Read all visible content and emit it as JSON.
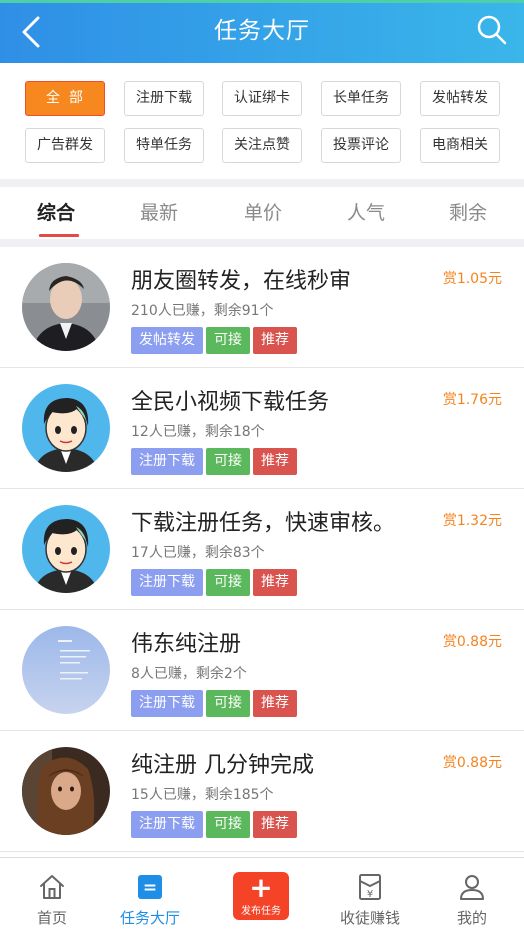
{
  "header": {
    "title": "任务大厅"
  },
  "filters": [
    "全部",
    "注册下载",
    "认证绑卡",
    "长单任务",
    "发帖转发",
    "广告群发",
    "特单任务",
    "关注点赞",
    "投票评论",
    "电商相关"
  ],
  "sort_tabs": [
    "综合",
    "最新",
    "单价",
    "人气",
    "剩余"
  ],
  "tasks": [
    {
      "title": "朋友圈转发，在线秒审",
      "meta": "210人已赚，剩余91个",
      "reward": "赏1.05元",
      "tags": [
        "发帖转发",
        "可接",
        "推荐"
      ]
    },
    {
      "title": "全民小视频下载任务",
      "meta": "12人已赚，剩余18个",
      "reward": "赏1.76元",
      "tags": [
        "注册下载",
        "可接",
        "推荐"
      ]
    },
    {
      "title": "下载注册任务，快速审核。",
      "meta": "17人已赚，剩余83个",
      "reward": "赏1.32元",
      "tags": [
        "注册下载",
        "可接",
        "推荐"
      ]
    },
    {
      "title": "伟东纯注册",
      "meta": "8人已赚，剩余2个",
      "reward": "赏0.88元",
      "tags": [
        "注册下载",
        "可接",
        "推荐"
      ]
    },
    {
      "title": "纯注册 几分钟完成",
      "meta": "15人已赚，剩余185个",
      "reward": "赏0.88元",
      "tags": [
        "注册下载",
        "可接",
        "推荐"
      ]
    }
  ],
  "tabbar": {
    "home": "首页",
    "hall": "任务大厅",
    "publish": "发布任务",
    "recruit": "收徒赚钱",
    "mine": "我的",
    "yuan_symbol": "¥",
    "hall_icon_glyph": "="
  }
}
